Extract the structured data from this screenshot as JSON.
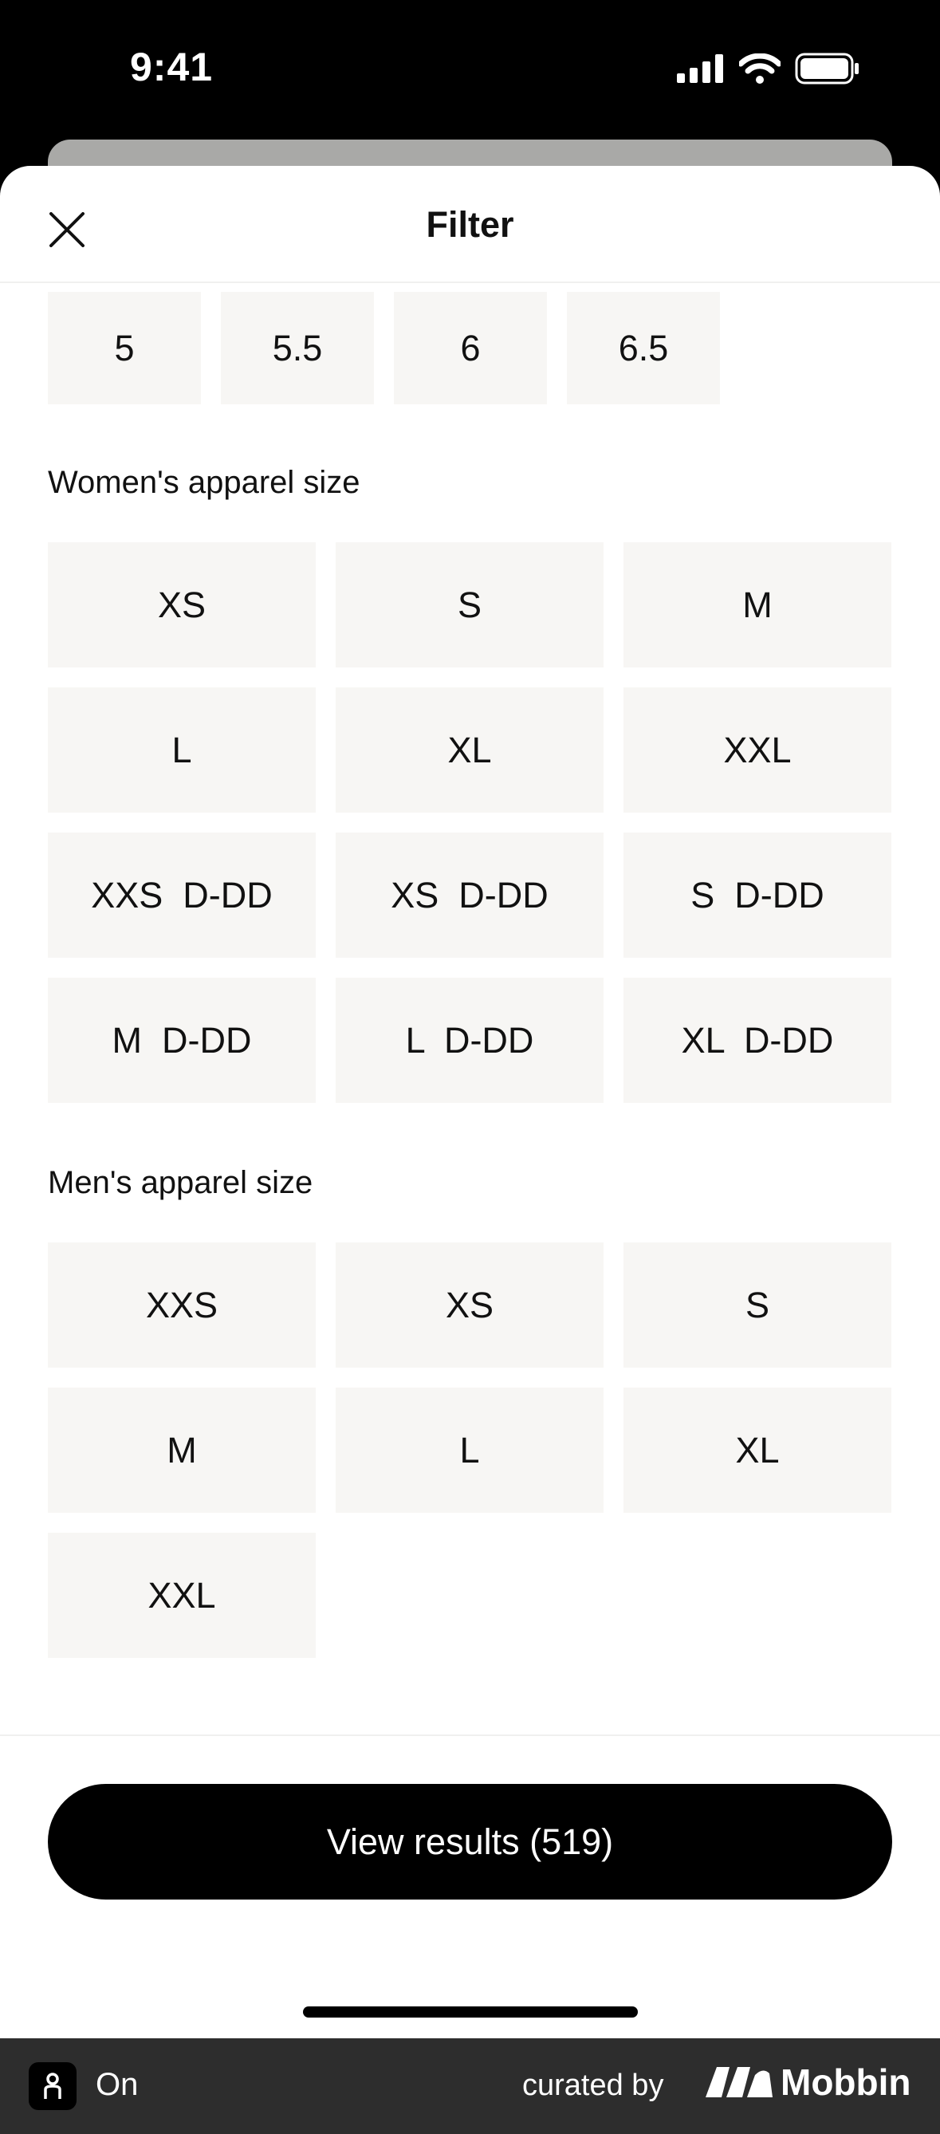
{
  "status_bar": {
    "time": "9:41"
  },
  "header": {
    "title": "Filter"
  },
  "shoe_sizes": [
    "5",
    "5.5",
    "6",
    "6.5"
  ],
  "womens": {
    "label": "Women's apparel size",
    "sizes": [
      "XS",
      "S",
      "M",
      "L",
      "XL",
      "XXL",
      "XXS  D-DD",
      "XS  D-DD",
      "S  D-DD",
      "M  D-DD",
      "L  D-DD",
      "XL  D-DD"
    ]
  },
  "mens": {
    "label": "Men's apparel size",
    "sizes": [
      "XXS",
      "XS",
      "S",
      "M",
      "L",
      "XL",
      "XXL"
    ]
  },
  "cta": {
    "label": "View results (519)"
  },
  "footer": {
    "app_name": "On",
    "curated_by": "curated by",
    "brand": "Mobbin"
  },
  "colors": {
    "chip_bg": "#f7f6f4",
    "cta_bg": "#000000",
    "footer_bg": "#2d2d2d"
  }
}
